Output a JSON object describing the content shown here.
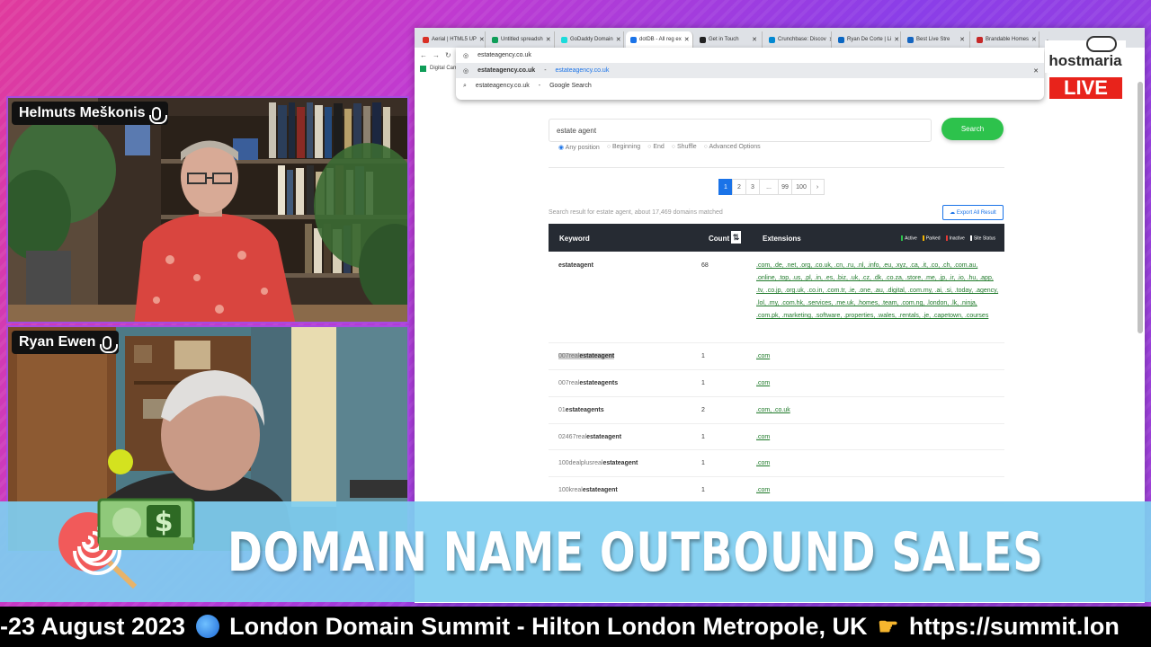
{
  "participants": [
    {
      "name": "Helmuts Meškonis"
    },
    {
      "name": "Ryan Ewen"
    }
  ],
  "browser": {
    "tabs": [
      {
        "label": "Aerial | HTML5 UP",
        "color": "#d93025"
      },
      {
        "label": "Untitled spreadsh",
        "color": "#0f9d58"
      },
      {
        "label": "GoDaddy Domain",
        "color": "#1bdbdb"
      },
      {
        "label": "dotDB - All reg ex",
        "color": "#1a73e8",
        "active": true
      },
      {
        "label": "Get in Touch",
        "color": "#222222"
      },
      {
        "label": "Crunchbase: Discov",
        "color": "#0288d1"
      },
      {
        "label": "Ryan De Corte | Li",
        "color": "#0a66c2"
      },
      {
        "label": "Best Live Stre",
        "color": "#1565c0"
      },
      {
        "label": "Brandable Homes",
        "color": "#c62828"
      }
    ],
    "url": "estateagency.co.uk",
    "bookmark": "Digital Camp",
    "omnibox_suggestions": [
      {
        "main": "estateagency.co.uk",
        "sub": "estateagency.co.uk"
      },
      {
        "main": "estateagency.co.uk",
        "sub": "Google Search"
      }
    ]
  },
  "search": {
    "query": "estate agent",
    "button": "Search",
    "options": [
      "Any position",
      "Beginning",
      "End",
      "Shuffle",
      "Advanced Options"
    ]
  },
  "pagination": [
    "1",
    "2",
    "3",
    "...",
    "99",
    "100",
    "›"
  ],
  "result_info": "Search result for estate agent, about 17,469 domains matched",
  "export_label": "Export All Result",
  "table": {
    "headers": {
      "keyword": "Keyword",
      "count": "Count",
      "extensions": "Extensions"
    },
    "legend": [
      {
        "label": "Active",
        "color": "#2dc24c"
      },
      {
        "label": "Parked",
        "color": "#f4b400"
      },
      {
        "label": "Inactive",
        "color": "#e53935"
      },
      {
        "label": "Site Status",
        "color": "#ffffff"
      }
    ],
    "rows": [
      {
        "pre": "",
        "bold": "estateagent",
        "count": "68",
        "ext": ".com, .de, .net, .org, .co.uk, .cn, .ru, .nl, .info, .eu, .xyz, .ca, .it, .co, .ch, .com.au, .online, .top, .us, .pl, .in, .es, .biz, .uk, .cz, .dk, .co.za, .store, .me, .jp, .ir, .io, .hu, .app, .tv, .co.jp, .org.uk, .co.in, .com.tr, .ie, .one, .au, .digital, .com.my, .ai, .si, .today, .agency, .lol, .my, .com.hk, .services, .me.uk, .homes, .team, .com.ng, .london, .lk, .ninja, .com.pk, .marketing, .software, .properties, .wales, .rentals, .je, .capetown, .courses"
      },
      {
        "pre": "007real",
        "bold": "estateagent",
        "count": "1",
        "ext": ".com"
      },
      {
        "pre": "007real",
        "bold": "estateagents",
        "count": "1",
        "ext": ".com"
      },
      {
        "pre": "01",
        "bold": "estateagents",
        "count": "2",
        "ext": ".com, .co.uk"
      },
      {
        "pre": "02467real",
        "bold": "estateagent",
        "count": "1",
        "ext": ".com"
      },
      {
        "pre": "100dealplusreal",
        "bold": "estateagent",
        "count": "1",
        "ext": ".com"
      },
      {
        "pre": "100kreal",
        "bold": "estateagent",
        "count": "1",
        "ext": ".com"
      }
    ]
  },
  "overlay": {
    "brand": "hostmaria",
    "live": "LIVE",
    "banner_title": "DOMAIN NAME OUTBOUND SALES",
    "ticker_part1": "-23 August 2023",
    "ticker_part2": "London Domain Summit - Hilton London Metropole, UK",
    "ticker_part3": "https://summit.lon"
  }
}
